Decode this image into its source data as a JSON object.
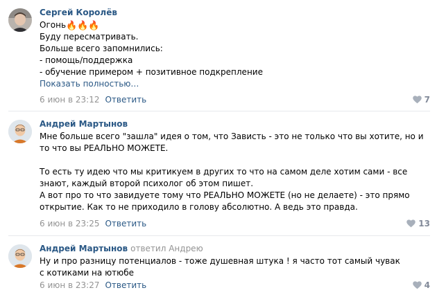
{
  "comments": [
    {
      "author": "Сергей Королёв",
      "reply_to": "",
      "text_first": "Огонь",
      "fire_emoji": "🔥🔥🔥",
      "lines": [
        "Буду пересматривать.",
        "Больше всего запомнились:",
        "- помощь/поддержка",
        "- обучение примером + позитивное подкрепление"
      ],
      "show_more": "Показать полностью…",
      "date": "6 июн в 23:12",
      "reply_label": "Ответить",
      "likes": "7",
      "avatar_icon": "avatar-photo-sergey"
    },
    {
      "author": "Андрей Мартынов",
      "reply_to": "",
      "paragraph1": "Мне больше всего \"зашла\" идея о том, что Зависть - это не только что вы хотите, но и то что вы РЕАЛЬНО МОЖЕТЕ.",
      "paragraph2": "То есть ту идею что мы критикуем в других то что на самом деле хотим сами - все знают, каждый второй психолог об этом пишет.",
      "paragraph3": "А вот про то что завидуете тому что РЕАЛЬНО МОЖЕТЕ (но не делаете) - это прямо открытие. Как то не приходило в голову абсолютно. А ведь это правда.",
      "date": "6 июн в 23:25",
      "reply_label": "Ответить",
      "likes": "13",
      "avatar_icon": "avatar-photo-andrey"
    },
    {
      "author": "Андрей Мартынов",
      "reply_to": "ответил Андрею",
      "text": "Ну и про разницу потенциалов - тоже душевная штука ! я часто тот самый чувак с котиками на ютюбе",
      "date": "6 июн в 23:27",
      "reply_label": "Ответить",
      "likes": "4",
      "avatar_icon": "avatar-photo-andrey"
    }
  ],
  "colors": {
    "link": "#2a5885",
    "meta": "#939393",
    "like": "#828a99",
    "separator": "#e7e8ec"
  },
  "icons": {
    "like": "heart-icon"
  }
}
